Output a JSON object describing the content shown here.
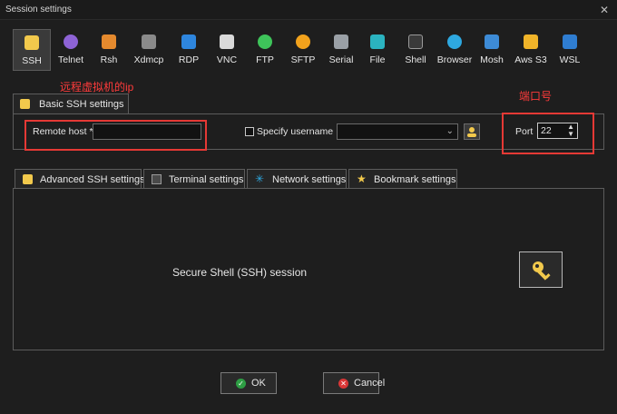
{
  "window": {
    "title": "Session settings",
    "close": "✕"
  },
  "protocols": [
    {
      "label": "SSH",
      "icon": "key-icon",
      "color": "#f2c94c",
      "active": true
    },
    {
      "label": "Telnet",
      "icon": "telnet-icon",
      "color": "#8e63d6"
    },
    {
      "label": "Rsh",
      "icon": "rsh-icon",
      "color": "#e58a2e"
    },
    {
      "label": "Xdmcp",
      "icon": "xdmcp-icon",
      "color": "#8a8a8a"
    },
    {
      "label": "RDP",
      "icon": "rdp-icon",
      "color": "#2e86de"
    },
    {
      "label": "VNC",
      "icon": "vnc-icon",
      "color": "#d9d9d9"
    },
    {
      "label": "FTP",
      "icon": "ftp-icon",
      "color": "#3ec45a"
    },
    {
      "label": "SFTP",
      "icon": "sftp-icon",
      "color": "#f2a21c"
    },
    {
      "label": "Serial",
      "icon": "serial-icon",
      "color": "#9aa0a6"
    },
    {
      "label": "File",
      "icon": "file-icon",
      "color": "#2bb3c0"
    },
    {
      "label": "Shell",
      "icon": "shell-icon",
      "color": "#5a5a5a"
    },
    {
      "label": "Browser",
      "icon": "browser-icon",
      "color": "#2ea8e0"
    },
    {
      "label": "Mosh",
      "icon": "mosh-icon",
      "color": "#3d8bd6"
    },
    {
      "label": "Aws S3",
      "icon": "aws-s3-icon",
      "color": "#f0b429"
    },
    {
      "label": "WSL",
      "icon": "wsl-icon",
      "color": "#2f7dd1"
    }
  ],
  "annotations": {
    "remote_vm_ip": "远程虚拟机的ip",
    "port": "端口号"
  },
  "basic": {
    "tab_label": "Basic SSH settings",
    "remote_host_label": "Remote host *",
    "remote_host_value": "",
    "specify_username_label": "Specify username",
    "username_value": "",
    "port_label": "Port",
    "port_value": "22"
  },
  "subtabs": [
    {
      "label": "Advanced SSH settings",
      "icon": "wrench-icon"
    },
    {
      "label": "Terminal settings",
      "icon": "terminal-icon"
    },
    {
      "label": "Network settings",
      "icon": "network-icon"
    },
    {
      "label": "Bookmark settings",
      "icon": "star-icon"
    }
  ],
  "content": {
    "session_label": "Secure Shell (SSH) session"
  },
  "buttons": {
    "ok_label": "OK",
    "cancel_label": "Cancel",
    "ok_color": "#2e9e44",
    "cancel_color": "#d93636"
  }
}
